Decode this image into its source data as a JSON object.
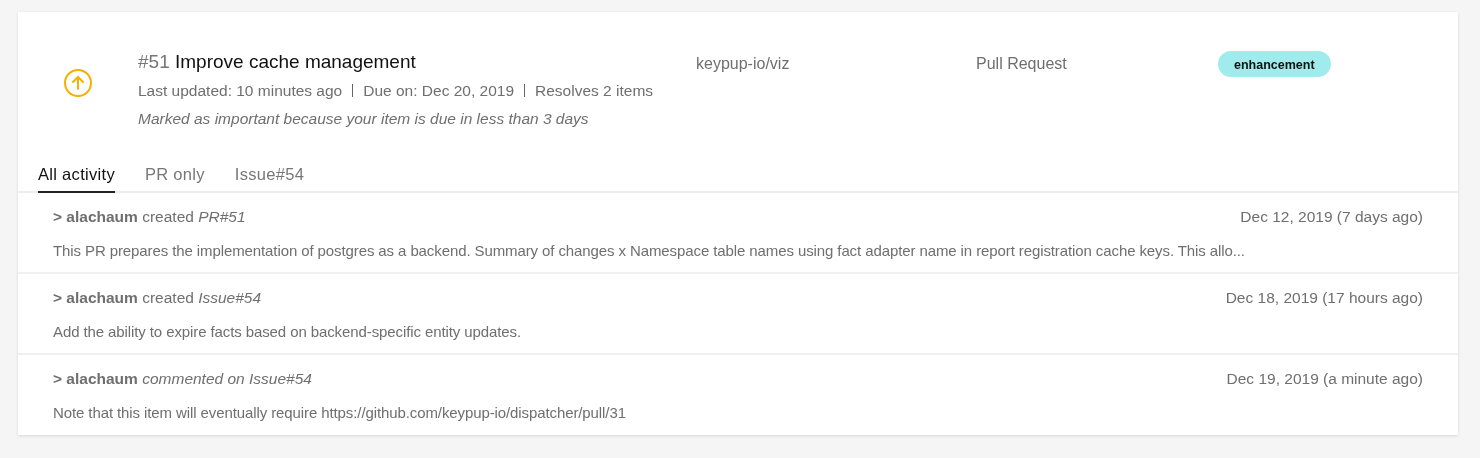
{
  "item": {
    "number": "#51",
    "title": "Improve cache management",
    "repository": "keypup-io/viz",
    "type": "Pull Request",
    "label": "enhancement",
    "meta": [
      "Last updated: 10 minutes ago",
      "Due on: Dec 20, 2019",
      "Resolves 2 items"
    ],
    "note": "Marked as important because your item is due in less than 3 days"
  },
  "tabs": [
    {
      "label": "All activity",
      "selected": true
    },
    {
      "label": "PR only",
      "selected": false
    },
    {
      "label": "Issue#54",
      "selected": false
    }
  ],
  "activities": [
    {
      "heading": "**> alachaum** created *PR#51*",
      "date": "Dec 12, 2019 (7 days ago)",
      "body": "This PR prepares the implementation of postgres as a backend. Summary of changes x Namespace table names using fact adapter name in report registration cache keys. This allo..."
    },
    {
      "heading": "**> alachaum** created *Issue#54*",
      "date": "Dec 18, 2019 (17 hours ago)",
      "body": "Add the ability to expire facts based on backend-specific entity updates."
    },
    {
      "heading": "**> alachaum** *commented on Issue#54*",
      "date": "Dec 19, 2019 (a minute ago)",
      "body": "Note that this item will eventually require https://github.com/keypup-io/dispatcher/pull/31"
    }
  ]
}
